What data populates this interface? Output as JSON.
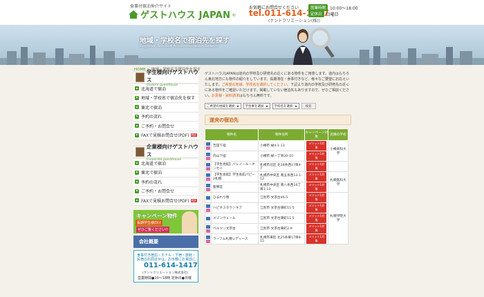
{
  "header": {
    "tagline": "食事付宿泊仲介サイト",
    "logo": "ゲストハウス JAPAN",
    "logo_reg": "®",
    "contact_label": "お気軽にお問合せください",
    "tel": "tel.011-614-1417",
    "company": "(ケントクリエーション(株))",
    "hours_label": "営業時間",
    "hours": "10:00～18:00",
    "closed_label": "定休日",
    "closed": "日曜日"
  },
  "banner": {
    "title": "地域・学校名で宿泊先を探す",
    "subtitle": "Regional Schools Accommodation Search"
  },
  "breadcrumb": {
    "home": "HOME",
    "sep": " > ",
    "current": "地域・学校名で宿泊先を探す"
  },
  "sidebar": {
    "student": {
      "title": "学生様向けゲストハウス",
      "subtitle": "Student guesthouse",
      "items": [
        "北海道で宿泊",
        "地域・学校名で宿泊先を探す",
        "東北で宿泊",
        "予約の流れ",
        "ご予約・お問合せ",
        "FAXで見積お問合せ(PDF)"
      ]
    },
    "corporate": {
      "title": "企業様向けゲストハウス",
      "subtitle": "Corporate guesthouse",
      "items": [
        "北海道で宿泊",
        "東北で宿泊",
        "予約の流れ",
        "ご予約・お問合せ",
        "FAXで見積お問合せ(PDF)"
      ]
    },
    "pdf_label": "PDF",
    "campaign": {
      "title": "キャンペーン物件",
      "sub": "長期学生様向け",
      "sub2": "ぜひご覧ください!!"
    },
    "about": "会社概要",
    "tel_box": {
      "line1": "食事付き宿泊・ホテル・下宿・旅館・",
      "line2": "民宿のお問合せは、お手軽にお電話に",
      "tel": "011-614-1417",
      "company": "(ケントクリエーション株式会社)",
      "hours": "営業時間●10～18時 定休日●日曜"
    }
  },
  "main": {
    "intro": [
      {
        "t": "ゲストハウスJAPANは道内の学校及び研修先の近くにある物件をご用意します。道内はもちろん東北地方にも物件の紹介をしています。長期滞在・食事付きなど、様々なご要望にお応えいたします。",
        "hl": false
      },
      {
        "t": "ご希望の地域、学校名を選択してください。",
        "hl": true
      },
      {
        "t": "下記より道内の学校及び研修先の近くにある物件をご確認いただけます。掲載していない宿泊先もありますので、ぜひご相談ください。",
        "hl": false
      },
      {
        "t": "お見積・資料請求",
        "hl": true
      },
      {
        "t": "はもちろん無料です。",
        "hl": false
      }
    ],
    "filters": {
      "area": "ご希望の地域を選択",
      "school": "学生寮を選択",
      "school2": "学校名を選択",
      "search": "検索"
    },
    "region": "道央の宿泊先",
    "table": {
      "headers": [
        "物件名",
        "物件住所",
        "キャンペーン対象",
        "近隣の学校"
      ],
      "badge": "メリット1対象",
      "rows": [
        {
          "name": "吉田下宿",
          "addr": "小樽市 緑4-1-13",
          "icons": [
            "b",
            "p"
          ],
          "school": "小樽商科大学",
          "school_rows": 2
        },
        {
          "name": "内山下宿",
          "addr": "小樽市 緑一丁目30-10",
          "icons": [
            "b",
            "p"
          ]
        },
        {
          "name": "【学生会館】パレノール・ネンセイ",
          "addr": "札幌市北区 北18条西17目4-7",
          "icons": [
            "b",
            "p"
          ],
          "school": "",
          "school_rows": 1
        },
        {
          "name": "【学生会館】学生会館パピー2札幌",
          "addr": "札幌市中央区 南五条西13-1-12",
          "icons": [
            "b",
            "p"
          ],
          "school": "札幌医科大学",
          "school_rows": 2
        },
        {
          "name": "聖寮荘",
          "addr": "札幌市中央区 南八条西16丁目1-13",
          "icons": [
            "b",
            "p"
          ]
        },
        {
          "name": "ひまわり寮",
          "addr": "江別市 文京台46-5",
          "icons": [
            "b"
          ],
          "school": "札幌学院大学",
          "school_rows": 6
        },
        {
          "name": "ハピネスタウンキア",
          "addr": "江別市 文京台東町11-5",
          "icons": [
            "b",
            "p"
          ]
        },
        {
          "name": "メゾンウェール",
          "addr": "江別市 文京台東町11-5",
          "icons": [
            "b"
          ]
        },
        {
          "name": "ベルツン文京台",
          "addr": "江別市 文京台東町2-9",
          "icons": [
            "b",
            "p"
          ]
        },
        {
          "name": "ラーフム札幌レディース",
          "addr": "札幌市東区 北25条東17目8-15",
          "icons": [
            "b",
            "p"
          ]
        }
      ]
    }
  },
  "colors": {
    "brand_green": "#4a9a2a",
    "accent_orange": "#e0601a",
    "table_header": "#7cab32",
    "badge_red": "#d8322a"
  }
}
